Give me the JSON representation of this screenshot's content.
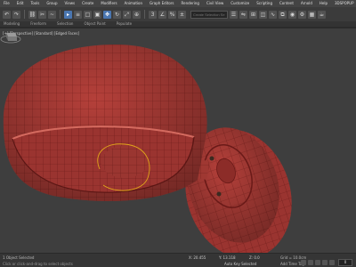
{
  "menubar": {
    "items": [
      "File",
      "Edit",
      "Tools",
      "Group",
      "Views",
      "Create",
      "Modifiers",
      "Animation",
      "Graph Editors",
      "Rendering",
      "Civil View",
      "Customize",
      "Scripting",
      "Content",
      "Arnold",
      "Help",
      "3DSPOPUP",
      "rapidTools"
    ]
  },
  "toolbar": {
    "buttons": [
      "undo-icon",
      "redo-icon",
      "link-icon",
      "unlink-icon",
      "bind-icon",
      "select-icon",
      "select-name-icon",
      "rect-select-icon",
      "window-icon",
      "move-icon",
      "rotate-icon",
      "scale-icon",
      "place-icon",
      "snap-icon",
      "angle-snap-icon",
      "percent-snap-icon",
      "spinner-snap-icon"
    ],
    "selection_set_placeholder": "Create Selection Se",
    "accent": "#4a76b0"
  },
  "ribbon": {
    "tabs": [
      "Modeling",
      "Freeform",
      "Selection",
      "Object Paint",
      "Populate"
    ]
  },
  "viewport": {
    "label": "[+] [Perspective] [Standard] [Edged Faces]",
    "background": "#3e3e3e",
    "model_color": "#b5403a",
    "wire_color": "#7a1f1c"
  },
  "status": {
    "selection": "1 Object Selected",
    "hint": "Click or click-and-drag to select objects",
    "x_value": "X: 20.455",
    "y_value": "Y: 13.118",
    "z_value": "Z: 0.0",
    "grid": "Grid = 10.0cm",
    "add_time_tag": "Add Time Tag",
    "key_mode": "Auto Key  Selected",
    "frame": "0"
  }
}
